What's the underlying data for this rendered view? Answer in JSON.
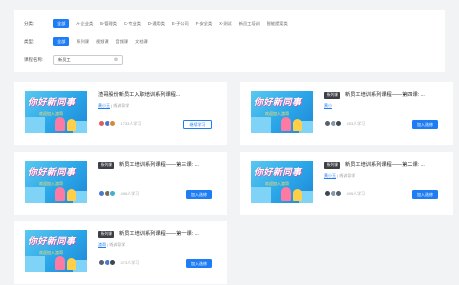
{
  "filters": {
    "category_label": "分类:",
    "categories": [
      "全部",
      "A-企业类",
      "B-管理类",
      "C-专业类",
      "D-通用类",
      "E-子公司",
      "F-安全类",
      "X-测试",
      "新员工培训",
      "智能提案类"
    ],
    "type_label": "类型:",
    "types": [
      "全部",
      "系列课",
      "视频课",
      "音频课",
      "文档课"
    ],
    "course_name_label": "课程名称:",
    "search_value": "新员工"
  },
  "cards": [
    {
      "badge": "",
      "title": "渣哥股份新员工入职培训系列课程...",
      "author": "黄小玉",
      "detail": "线训导学",
      "learners": "1733人学习",
      "button": "继续学习",
      "button_style": "outline"
    },
    {
      "badge": "系列课",
      "title": "新员工培训系列课程——第四课: ...",
      "author": "黄小",
      "detail": "",
      "learners": "453人学习",
      "button": "加入选修",
      "button_style": "primary"
    },
    {
      "badge": "系列课",
      "title": "新员工培训系列课程——第三课: ...",
      "author": "",
      "detail": "",
      "learners": "496人学习",
      "button": "加入选修",
      "button_style": "primary"
    },
    {
      "badge": "系列课",
      "title": "新员工培训系列课程——第二课: ...",
      "author": "黄小玉",
      "detail": "|  线训导学",
      "learners": "495人学习",
      "button": "加入选修",
      "button_style": "primary"
    },
    {
      "badge": "系列课",
      "title": "新员工培训系列课程——第一课: ...",
      "author": "渣哥",
      "detail": "|  线训导学",
      "learners": "473人学习",
      "button": "加入选修",
      "button_style": "primary"
    }
  ],
  "thumbnail": {
    "headline": "你好新同事",
    "subline": "欢迎加入渣哥"
  },
  "colors": {
    "accent": "#1e7df5",
    "badge": "#3d3f45"
  }
}
